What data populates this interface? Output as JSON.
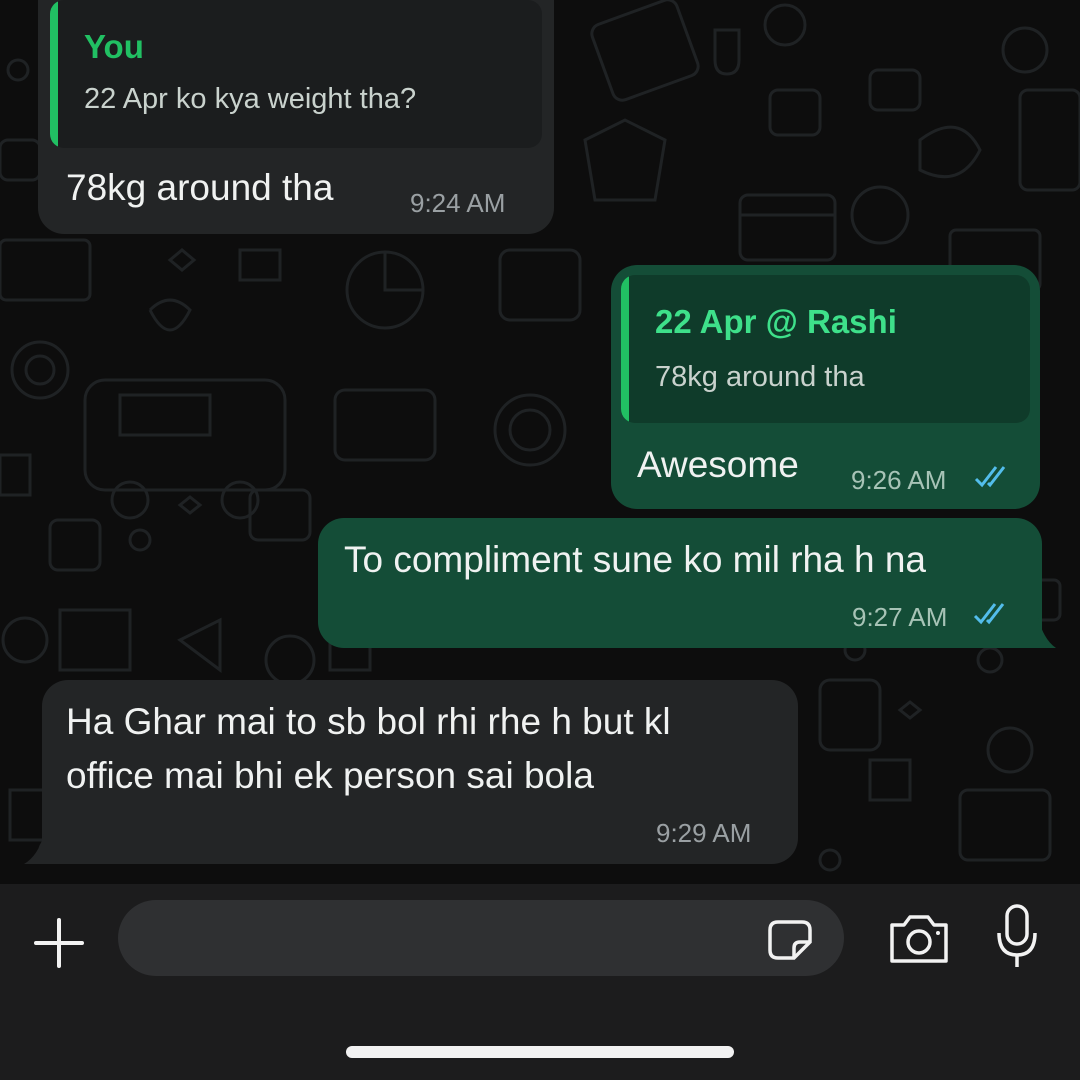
{
  "colors": {
    "incoming_bubble": "#232526",
    "outgoing_bubble": "#144d37",
    "quote_accent": "#21c063",
    "read_ticks": "#53bdeb"
  },
  "messages": [
    {
      "direction": "incoming",
      "quote": {
        "author": "You",
        "text": "22 Apr ko kya weight tha?"
      },
      "lines": [
        "78kg around tha"
      ],
      "time": "9:24 AM"
    },
    {
      "direction": "outgoing",
      "quote": {
        "author": "22 Apr @ Rashi",
        "text": "78kg around tha"
      },
      "lines": [
        "Awesome"
      ],
      "time": "9:26 AM",
      "status": "read"
    },
    {
      "direction": "outgoing",
      "lines": [
        "To compliment sune ko mil rha h na"
      ],
      "time": "9:27 AM",
      "status": "read"
    },
    {
      "direction": "incoming",
      "lines": [
        "Ha Ghar mai to sb bol rhi rhe h but kl",
        "office mai bhi ek person sai bola"
      ],
      "time": "9:29 AM"
    }
  ],
  "composer": {
    "message_value": "",
    "icons": {
      "attach": "plus-icon",
      "sticker": "sticker-icon",
      "camera": "camera-icon",
      "mic": "microphone-icon"
    }
  }
}
